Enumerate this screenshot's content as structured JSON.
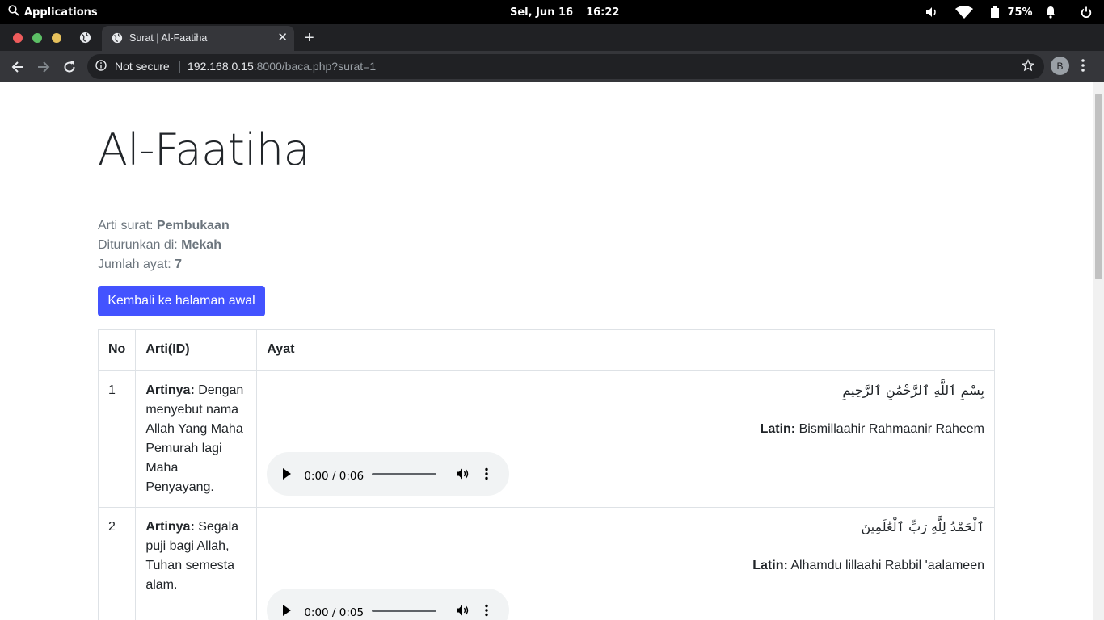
{
  "system_bar": {
    "applications_label": "Applications",
    "date": "Sel, Jun 16",
    "time": "16:22",
    "battery": "75%"
  },
  "browser": {
    "tab_title": "Surat | Al-Faatiha",
    "security_label": "Not secure",
    "url_host": "192.168.0.15",
    "url_rest": ":8000/baca.php?surat=1",
    "profile_initial": "B"
  },
  "page": {
    "title": "Al-Faatiha",
    "meta": {
      "arti_label": "Arti surat: ",
      "arti_value": "Pembukaan",
      "turun_label": "Diturunkan di: ",
      "turun_value": "Mekah",
      "jumlah_label": "Jumlah ayat: ",
      "jumlah_value": "7"
    },
    "back_button": "Kembali ke halaman awal",
    "table": {
      "headers": [
        "No",
        "Arti(ID)",
        "Ayat"
      ],
      "rows": [
        {
          "no": "1",
          "arti_label": "Artinya:",
          "arti_text": " Dengan menyebut nama Allah Yang Maha Pemurah lagi Maha Penyayang.",
          "arab": "بِسْمِ ٱللَّهِ ٱلرَّحْمَٰنِ ٱلرَّحِيمِ",
          "latin_label": "Latin:",
          "latin_text": " Bismillaahir Rahmaanir Raheem",
          "audio_time": "0:00 / 0:06"
        },
        {
          "no": "2",
          "arti_label": "Artinya:",
          "arti_text": " Segala puji bagi Allah, Tuhan semesta alam.",
          "arab": "ٱلْحَمْدُ لِلَّهِ رَبِّ ٱلْعَٰلَمِينَ",
          "latin_label": "Latin:",
          "latin_text": " Alhamdu lillaahi Rabbil 'aalameen",
          "audio_time": "0:00 / 0:05"
        }
      ]
    }
  }
}
